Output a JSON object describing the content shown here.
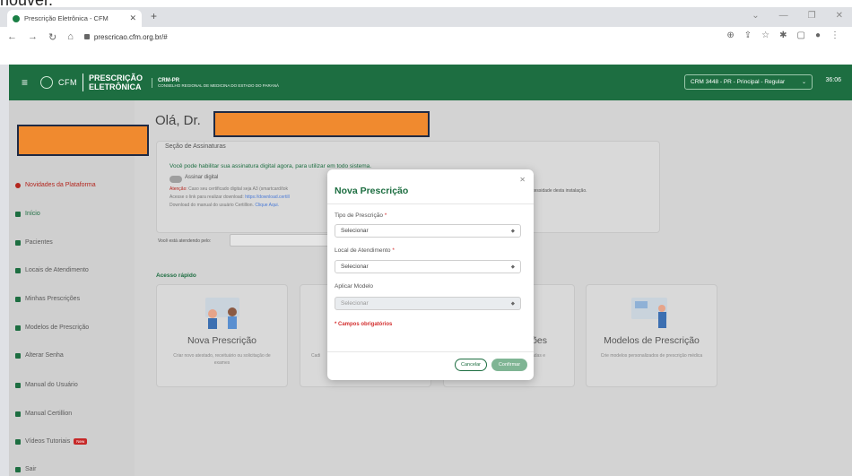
{
  "browser": {
    "top_cut_text": "houver.",
    "tab_title": "Prescrição Eletrônica - CFM",
    "url": "prescricao.cfm.org.br/#"
  },
  "header": {
    "logo_cfm": "CFM",
    "logo_line1": "PRESCRIÇÃO",
    "logo_line2": "ELETRÔNICA",
    "org_title": "CRM-PR",
    "org_subtitle": "CONSELHO REGIONAL DE MEDICINA DO ESTADO DO PARANÁ",
    "crm_select": "CRM 3448 - PR - Principal - Regular",
    "timer": "36:06"
  },
  "sidebar": {
    "items": [
      {
        "label": "Novidades da Plataforma"
      },
      {
        "label": "Início"
      },
      {
        "label": "Pacientes"
      },
      {
        "label": "Locais de Atendimento"
      },
      {
        "label": "Minhas Prescrições"
      },
      {
        "label": "Modelos de Prescrição"
      },
      {
        "label": "Alterar Senha"
      },
      {
        "label": "Manual do Usuário"
      },
      {
        "label": "Manual Certillion"
      },
      {
        "label": "Vídeos Tutoriais"
      },
      {
        "label": "Sair"
      }
    ],
    "new_badge": "New"
  },
  "main": {
    "greeting": "Olá, Dr.",
    "signature": {
      "section_title": "Seção de Assinaturas",
      "message": "Você pode habilitar sua assinatura digital agora, para utilizar em todo sistema.",
      "toggle_label": "Assinar digital",
      "attention_label": "Atenção:",
      "attention_text": "Caso seu certificado digital seja A3 (smartcard/tok",
      "download_text": "Acesse o link para realizar download:",
      "download_link": "https://download.certill",
      "manual_text": "Download do manual do usuário Certillion.",
      "manual_link": "Clique Aqui.",
      "right_note": "UVEM não há necessidade desta instalação."
    },
    "attending_label": "Você está atendendo pelo:",
    "quick_access": "Acesso rápido",
    "cards": [
      {
        "title": "Nova Prescrição",
        "desc": "Criar novo atestado, receituário ou solicitação de exames"
      },
      {
        "title": "",
        "desc": "Cadi"
      },
      {
        "title": "ões",
        "desc": "dadas e"
      },
      {
        "title": "Modelos de Prescrição",
        "desc": "Crie modelos personalizados de prescrição médica"
      }
    ]
  },
  "modal": {
    "title": "Nova Prescrição",
    "fields": [
      {
        "label": "Tipo de Prescrição",
        "required": "*",
        "value": "Selecionar"
      },
      {
        "label": "Local de Atendimento",
        "required": "*",
        "value": "Selecionar"
      },
      {
        "label": "Aplicar Modelo",
        "required": "",
        "value": "Selecionar"
      }
    ],
    "required_note": "* Campos obrigatórios",
    "cancel": "Cancelar",
    "confirm": "Confirmar"
  }
}
